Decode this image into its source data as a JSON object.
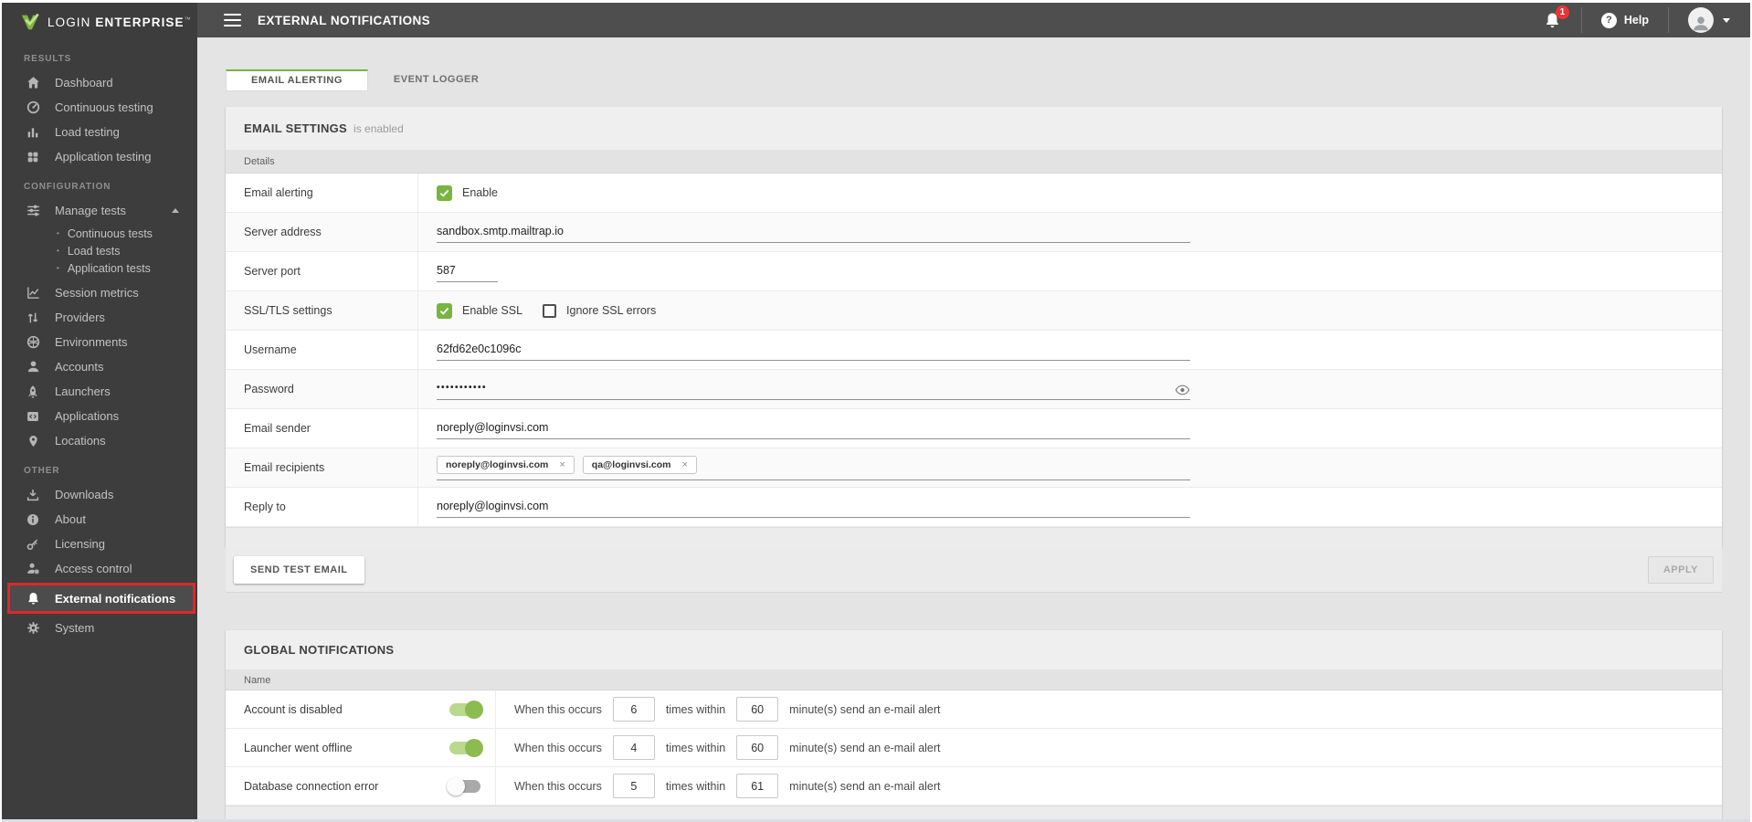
{
  "brand": {
    "word1": "LOGIN",
    "word2": "ENTERPRISE",
    "tm": "™"
  },
  "colors": {
    "accent_green": "#7cb342",
    "sidebar_bg": "#3d3d3d",
    "topbar_bg": "#4e4e4e",
    "alert_badge_red": "#e33333",
    "highlight_border_red": "#df2727"
  },
  "topbar": {
    "title": "EXTERNAL NOTIFICATIONS",
    "notification_count": "1",
    "help_mark": "?",
    "help_label": "Help"
  },
  "sidebar": {
    "sections": [
      {
        "label": "RESULTS",
        "items": [
          {
            "label": "Dashboard",
            "icon": "home-icon"
          },
          {
            "label": "Continuous testing",
            "icon": "gauge-icon"
          },
          {
            "label": "Load testing",
            "icon": "bar-chart-icon"
          },
          {
            "label": "Application testing",
            "icon": "app-grid-icon"
          }
        ]
      },
      {
        "label": "CONFIGURATION",
        "items": [
          {
            "label": "Manage tests",
            "icon": "sliders-icon",
            "expanded": true,
            "children": [
              "Continuous tests",
              "Load tests",
              "Application tests"
            ]
          },
          {
            "label": "Session metrics",
            "icon": "line-chart-icon"
          },
          {
            "label": "Providers",
            "icon": "swap-icon"
          },
          {
            "label": "Environments",
            "icon": "globe-icon"
          },
          {
            "label": "Accounts",
            "icon": "person-icon"
          },
          {
            "label": "Launchers",
            "icon": "rocket-icon"
          },
          {
            "label": "Applications",
            "icon": "code-icon"
          },
          {
            "label": "Locations",
            "icon": "pin-icon"
          }
        ]
      },
      {
        "label": "OTHER",
        "items": [
          {
            "label": "Downloads",
            "icon": "download-icon"
          },
          {
            "label": "About",
            "icon": "info-icon"
          },
          {
            "label": "Licensing",
            "icon": "key-icon"
          },
          {
            "label": "Access control",
            "icon": "person-gear-icon"
          },
          {
            "label": "External notifications",
            "icon": "bell-icon",
            "active": true
          },
          {
            "label": "System",
            "icon": "gear-icon"
          }
        ]
      }
    ]
  },
  "tabs": [
    {
      "label": "EMAIL ALERTING",
      "active": true
    },
    {
      "label": "EVENT LOGGER",
      "active": false
    }
  ],
  "email_settings": {
    "title": "EMAIL SETTINGS",
    "subtitle": "is enabled",
    "column_header": "Details",
    "fields": {
      "email_alerting_label": "Email alerting",
      "enable_label": "Enable",
      "server_address_label": "Server address",
      "server_address_value": "sandbox.smtp.mailtrap.io",
      "server_port_label": "Server port",
      "server_port_value": "587",
      "ssl_label": "SSL/TLS settings",
      "enable_ssl_label": "Enable SSL",
      "ignore_ssl_label": "Ignore SSL errors",
      "username_label": "Username",
      "username_value": "62fd62e0c1096c",
      "password_label": "Password",
      "password_value": "•••••••••••",
      "email_sender_label": "Email sender",
      "email_sender_value": "noreply@loginvsi.com",
      "email_recipients_label": "Email recipients",
      "recipients": [
        "noreply@loginvsi.com",
        "qa@loginvsi.com"
      ],
      "chip_close_glyph": "×",
      "reply_to_label": "Reply to",
      "reply_to_value": "noreply@loginvsi.com"
    },
    "send_test_email_label": "SEND TEST EMAIL",
    "apply_label": "APPLY"
  },
  "global_notifications": {
    "title": "GLOBAL NOTIFICATIONS",
    "column_header": "Name",
    "occurs_prefix": "When this occurs",
    "within_label": "times within",
    "suffix_label": "minute(s) send an e-mail alert",
    "rows": [
      {
        "name": "Account is disabled",
        "enabled": true,
        "occurs": "6",
        "within": "60"
      },
      {
        "name": "Launcher went offline",
        "enabled": true,
        "occurs": "4",
        "within": "60"
      },
      {
        "name": "Database connection error",
        "enabled": false,
        "occurs": "5",
        "within": "61"
      }
    ]
  }
}
